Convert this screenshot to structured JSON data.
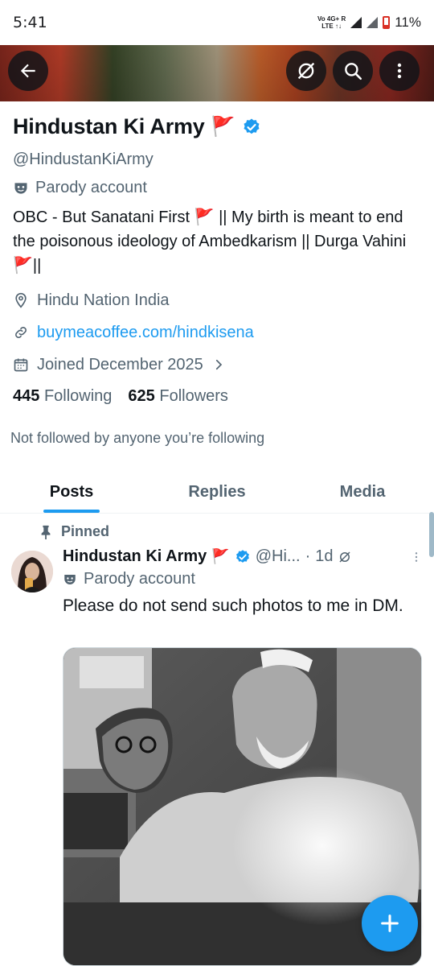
{
  "status_bar": {
    "time": "5:41",
    "network_top": "Vo 4G+ R",
    "network_bottom": "LTE ↑↓",
    "battery": "11%"
  },
  "profile": {
    "display_name": "Hindustan Ki Army",
    "name_flag": "🚩",
    "handle": "@HindustanKiArmy",
    "parody_label": "Parody account",
    "bio": "OBC - But Sanatani First 🚩 ||  My birth is meant to end the poisonous ideology of Ambedkarism || Durga Vahini 🚩||",
    "location": "Hindu Nation India",
    "link": "buymeacoffee.com/hindkisena",
    "joined": "Joined December 2025",
    "following_count": "445",
    "following_label": "Following",
    "followers_count": "625",
    "followers_label": "Followers",
    "not_followed": "Not followed by anyone you’re following"
  },
  "tabs": [
    {
      "label": "Posts",
      "active": true
    },
    {
      "label": "Replies",
      "active": false
    },
    {
      "label": "Media",
      "active": false
    }
  ],
  "post": {
    "pinned_label": "Pinned",
    "author_name": "Hindustan Ki Army",
    "author_flag": "🚩",
    "handle": "@Hi...",
    "time": "1d",
    "parody_label": "Parody account",
    "text": "Please do not send such photos to me in DM."
  },
  "icons": {
    "back": "back-arrow-icon",
    "grok": "grok-icon",
    "search": "search-icon",
    "more": "more-vertical-icon",
    "verified": "verified-badge-icon",
    "parody": "parody-mask-icon",
    "location": "location-pin-icon",
    "link": "link-icon",
    "calendar": "calendar-icon",
    "pin": "pin-icon",
    "compose": "plus-icon"
  },
  "colors": {
    "accent": "#1d9bf0",
    "text": "#0f1419",
    "secondary": "#536471",
    "flag": "#e0245e"
  }
}
